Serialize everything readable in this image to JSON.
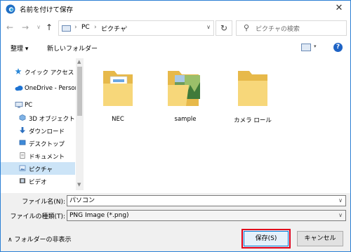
{
  "window": {
    "title": "名前を付けて保存",
    "close_glyph": "✕"
  },
  "nav": {
    "back": "←",
    "forward": "→",
    "recent": "∨",
    "up": "↑"
  },
  "address": {
    "crumbs": [
      "PC",
      "ピクチャ"
    ],
    "separator": "›",
    "dropdown": "∨"
  },
  "search": {
    "placeholder": "ピクチャの検索"
  },
  "toolbar": {
    "organize_label": "整理 ▾",
    "new_folder_label": "新しいフォルダー",
    "view_arrow": "▾",
    "help_glyph": "?"
  },
  "sidebar": {
    "items": [
      {
        "label": "クイック アクセス",
        "icon": "star-icon"
      },
      {
        "label": "OneDrive - Person",
        "icon": "cloud-icon"
      },
      {
        "label": "PC",
        "icon": "computer-icon"
      },
      {
        "label": "3D オブジェクト",
        "icon": "cube-icon"
      },
      {
        "label": "ダウンロード",
        "icon": "download-icon"
      },
      {
        "label": "デスクトップ",
        "icon": "desktop-icon"
      },
      {
        "label": "ドキュメント",
        "icon": "document-icon"
      },
      {
        "label": "ピクチャ",
        "icon": "pictures-icon",
        "selected": true
      },
      {
        "label": "ビデオ",
        "icon": "video-icon"
      }
    ]
  },
  "files": [
    {
      "name": "NEC",
      "icon": "folder-with-documents-icon"
    },
    {
      "name": "sample",
      "icon": "folder-with-photos-icon"
    },
    {
      "name": "カメラ ロール",
      "icon": "folder-icon"
    }
  ],
  "form": {
    "filename_label": "ファイル名(N):",
    "filename_value": "パソコン",
    "filetype_label": "ファイルの種類(T):",
    "filetype_value": "PNG Image (*.png)",
    "dropdown_glyph": "∨"
  },
  "footer": {
    "toggle_folders_label": "∧ フォルダーの非表示",
    "save_label": "保存(S)",
    "cancel_label": "キャンセル"
  },
  "colors": {
    "accent": "#0078d7",
    "highlight": "#cce4f7",
    "folder": "#f7d77a",
    "save_outline": "#e0001b"
  }
}
